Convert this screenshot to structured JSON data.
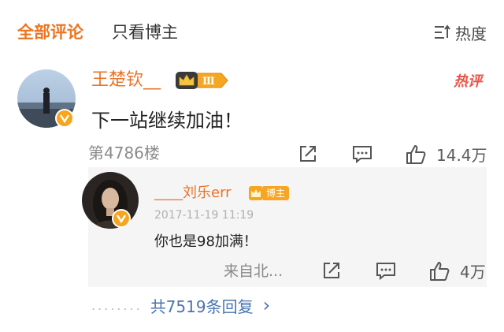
{
  "header": {
    "tab_all": "全部评论",
    "tab_blogger": "只看博主",
    "sort_label": "热度"
  },
  "comment": {
    "username": "王楚钦__",
    "level_badge": "Ⅲ",
    "hot_tag": "热评",
    "text": "下一站继续加油！",
    "floor": "第4786楼",
    "likes": "14.4万"
  },
  "reply": {
    "username": "____刘乐err",
    "role_badge": "博主",
    "date": "2017-11-19 11:19",
    "text": "你也是98加满！",
    "source": "来自北...",
    "likes": "4万"
  },
  "more_replies": {
    "dots": "........",
    "label": "共7519条回复",
    "arrow": "›"
  },
  "colors": {
    "accent_orange": "#ec7522",
    "hot_red": "#e8554a",
    "link_blue": "#4a74b0",
    "badge_gold": "#f6a623"
  },
  "icons": [
    "sort-icon",
    "verified-icon",
    "crown-icon",
    "repost-icon",
    "comment-icon",
    "like-icon",
    "chevron-right-icon"
  ]
}
